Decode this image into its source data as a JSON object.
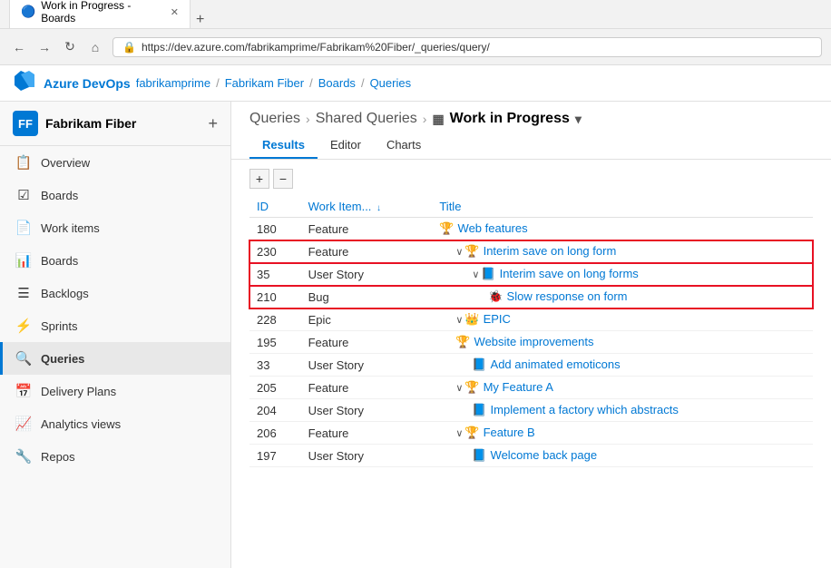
{
  "browser": {
    "tab_label": "Work in Progress - Boards",
    "url": "https://dev.azure.com/fabrikamprime/Fabrikam%20Fiber/_queries/query/",
    "back_btn": "◀",
    "forward_btn": "▶",
    "refresh_btn": "↺",
    "home_btn": "⌂",
    "lock_icon": "🔒",
    "new_tab_btn": "+"
  },
  "app_header": {
    "logo_text": "Azure DevOps",
    "org": "fabrikamprime",
    "sep1": "/",
    "project": "Fabrikam Fiber",
    "sep2": "/",
    "section": "Boards",
    "sep3": "/",
    "page": "Queries"
  },
  "sidebar": {
    "project_avatar": "FF",
    "project_name": "Fabrikam Fiber",
    "plus_btn": "+",
    "items": [
      {
        "id": "overview",
        "label": "Overview",
        "icon": "📋"
      },
      {
        "id": "boards-section",
        "label": "Boards",
        "icon": "☑"
      },
      {
        "id": "work-items",
        "label": "Work items",
        "icon": "📄"
      },
      {
        "id": "boards",
        "label": "Boards",
        "icon": "📊"
      },
      {
        "id": "backlogs",
        "label": "Backlogs",
        "icon": "☰"
      },
      {
        "id": "sprints",
        "label": "Sprints",
        "icon": "⚡"
      },
      {
        "id": "queries",
        "label": "Queries",
        "icon": "🔍",
        "active": true
      },
      {
        "id": "delivery-plans",
        "label": "Delivery Plans",
        "icon": "📅"
      },
      {
        "id": "analytics-views",
        "label": "Analytics views",
        "icon": "📈"
      },
      {
        "id": "repos",
        "label": "Repos",
        "icon": "🔧"
      }
    ]
  },
  "main": {
    "breadcrumbs": [
      {
        "label": "Queries"
      },
      {
        "label": "Shared Queries"
      },
      {
        "label": "Work in Progress"
      }
    ],
    "title_icon": "▦",
    "title_dropdown": "▾",
    "tabs": [
      {
        "label": "Results",
        "active": true
      },
      {
        "label": "Editor",
        "active": false
      },
      {
        "label": "Charts",
        "active": false
      }
    ],
    "expand_btn": "+",
    "collapse_btn": "−",
    "columns": [
      {
        "label": "ID",
        "sortable": false
      },
      {
        "label": "Work Item...",
        "sortable": true
      },
      {
        "label": "Title",
        "sortable": false
      }
    ],
    "rows": [
      {
        "id": "180",
        "type": "Feature",
        "type_class": "wi-feature",
        "type_icon": "🏆",
        "indent": 0,
        "chevron": false,
        "title": "Web features",
        "highlighted": false
      },
      {
        "id": "230",
        "type": "Feature",
        "type_class": "wi-feature",
        "type_icon": "🏆",
        "indent": 1,
        "chevron": true,
        "title": "Interim save on long form",
        "highlighted": true
      },
      {
        "id": "35",
        "type": "User Story",
        "type_class": "wi-story",
        "type_icon": "📘",
        "indent": 2,
        "chevron": true,
        "title": "Interim save on long forms",
        "highlighted": true
      },
      {
        "id": "210",
        "type": "Bug",
        "type_class": "wi-bug",
        "type_icon": "🐞",
        "indent": 3,
        "chevron": false,
        "title": "Slow response on form",
        "highlighted": true
      },
      {
        "id": "228",
        "type": "Epic",
        "type_class": "wi-epic",
        "type_icon": "👑",
        "indent": 1,
        "chevron": true,
        "title": "EPIC",
        "highlighted": false
      },
      {
        "id": "195",
        "type": "Feature",
        "type_class": "wi-feature",
        "type_icon": "🏆",
        "indent": 1,
        "chevron": false,
        "title": "Website improvements",
        "highlighted": false
      },
      {
        "id": "33",
        "type": "User Story",
        "type_class": "wi-story",
        "type_icon": "📘",
        "indent": 2,
        "chevron": false,
        "title": "Add animated emoticons",
        "highlighted": false
      },
      {
        "id": "205",
        "type": "Feature",
        "type_class": "wi-feature",
        "type_icon": "🏆",
        "indent": 1,
        "chevron": true,
        "title": "My Feature A",
        "highlighted": false
      },
      {
        "id": "204",
        "type": "User Story",
        "type_class": "wi-story",
        "type_icon": "📘",
        "indent": 2,
        "chevron": false,
        "title": "Implement a factory which abstracts",
        "highlighted": false
      },
      {
        "id": "206",
        "type": "Feature",
        "type_class": "wi-feature",
        "type_icon": "🏆",
        "indent": 1,
        "chevron": true,
        "title": "Feature B",
        "highlighted": false
      },
      {
        "id": "197",
        "type": "User Story",
        "type_class": "wi-story",
        "type_icon": "📘",
        "indent": 2,
        "chevron": false,
        "title": "Welcome back page",
        "highlighted": false
      }
    ]
  }
}
